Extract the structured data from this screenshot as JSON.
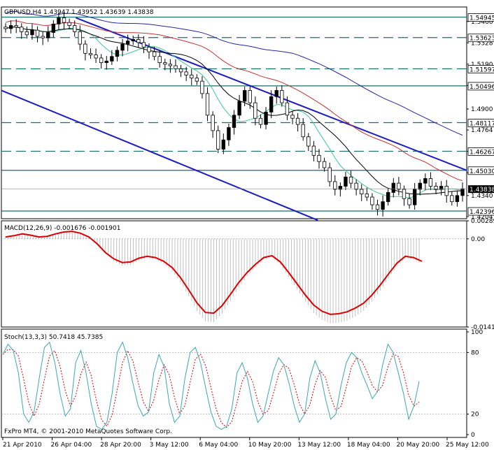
{
  "chart_data": [
    {
      "type": "candlestick",
      "title": "GBPUSD,H4",
      "ohlc_values": [
        "1.43947",
        "1.43952",
        "1.43639",
        "1.43838"
      ],
      "y_axis_ticks": [
        "1.5466",
        "1.5328",
        "1.5190",
        "1.5052",
        "1.4900",
        "1.4764",
        "1.4626",
        "1.4488",
        "1.4340",
        "1.4204"
      ],
      "ylim": [
        1.419,
        1.556
      ],
      "horizontal_levels": [
        {
          "price": 1.54945,
          "label": "1.54945",
          "style": "solid"
        },
        {
          "price": 1.53623,
          "label": "1.53623",
          "style": "dashed"
        },
        {
          "price": 1.51597,
          "label": "1.51597",
          "style": "dashed"
        },
        {
          "price": 1.50496,
          "label": "1.50496",
          "style": "solid"
        },
        {
          "price": 1.48117,
          "label": "1.48117",
          "style": "dashed"
        },
        {
          "price": 1.46267,
          "label": "1.46267",
          "style": "dashed"
        },
        {
          "price": 1.4503,
          "label": "1.45030",
          "style": "solid"
        },
        {
          "price": 1.42396,
          "label": "1.42396",
          "style": "solid"
        }
      ],
      "current_price": {
        "price": 1.43838,
        "label": "1.43838"
      },
      "trend_channel": {
        "upper": {
          "from": [
            0.16,
            1.549
          ],
          "to": [
            1.0,
            1.4503
          ]
        },
        "lower": {
          "from": [
            0.0,
            1.502
          ],
          "to": [
            0.68,
            1.418
          ]
        }
      },
      "close_prices": [
        1.542,
        1.544,
        1.543,
        1.54,
        1.538,
        1.541,
        1.537,
        1.536,
        1.5395,
        1.545,
        1.549,
        1.546,
        1.544,
        1.54,
        1.532,
        1.526,
        1.525,
        1.523,
        1.52,
        1.521,
        1.524,
        1.528,
        1.532,
        1.534,
        1.535,
        1.533,
        1.53,
        1.527,
        1.524,
        1.52,
        1.519,
        1.518,
        1.516,
        1.514,
        1.512,
        1.51,
        1.508,
        1.5,
        1.486,
        1.476,
        1.464,
        1.47,
        1.478,
        1.486,
        1.495,
        1.502,
        1.494,
        1.484,
        1.48,
        1.488,
        1.498,
        1.502,
        1.494,
        1.486,
        1.484,
        1.48,
        1.472,
        1.466,
        1.46,
        1.456,
        1.452,
        1.443,
        1.438,
        1.44,
        1.446,
        1.442,
        1.438,
        1.435,
        1.433,
        1.428,
        1.425,
        1.43,
        1.436,
        1.442,
        1.438,
        1.432,
        1.428,
        1.438,
        1.442,
        1.445,
        1.44,
        1.438,
        1.44,
        1.434,
        1.43,
        1.434,
        1.4384
      ],
      "moving_averages": [
        {
          "color": "#3ec89a"
        },
        {
          "color": "#000000"
        },
        {
          "color": "#c83232"
        },
        {
          "color": "#2626a0"
        }
      ],
      "x_axis_ticks": [
        "21 Apr 2010",
        "26 Apr 04:00",
        "28 Apr 20:00",
        "3 May 12:00",
        "6 May 04:00",
        "10 May 20:00",
        "13 May 12:00",
        "18 May 04:00",
        "20 May 20:00",
        "25 May 12:00"
      ],
      "copyright": "FxPro MT4, © 2001-2010 MetaQuotes Software Corp."
    },
    {
      "type": "macd",
      "title": "MACD(12,26,9)",
      "readout": [
        "-0.001676",
        "-0.001901"
      ],
      "y_axis_ticks": [
        "0.00289",
        "0.00",
        "-0.01413"
      ],
      "ylim": [
        -0.01413,
        0.00289
      ],
      "signal_color": "#dd0000",
      "histogram_color": "#c0c0c0",
      "main_values": [
        0.0003,
        0.0005,
        0.0008,
        0.0006,
        0.0003,
        0.0004,
        0.0008,
        0.0011,
        0.0012,
        0.0009,
        0.0003,
        -0.0008,
        -0.0022,
        -0.0032,
        -0.0038,
        -0.0037,
        -0.0031,
        -0.0028,
        -0.003,
        -0.0036,
        -0.0046,
        -0.0062,
        -0.0082,
        -0.0103,
        -0.0118,
        -0.0119,
        -0.0107,
        -0.0089,
        -0.007,
        -0.0054,
        -0.0041,
        -0.003,
        -0.0027,
        -0.0037,
        -0.0054,
        -0.0072,
        -0.009,
        -0.0106,
        -0.0116,
        -0.0121,
        -0.012,
        -0.0117,
        -0.0111,
        -0.0103,
        -0.009,
        -0.0074,
        -0.0056,
        -0.0039,
        -0.0028,
        -0.003,
        -0.0036
      ]
    },
    {
      "type": "stochastic",
      "title": "Stoch(13,3,3)",
      "readout": [
        "50.7418",
        "45.7385"
      ],
      "y_axis_ticks": [
        "100",
        "80",
        "20",
        "0"
      ],
      "ylim": [
        0,
        100
      ],
      "main_color": "#3aa8b0",
      "signal_color": "#dd0000",
      "main_values": [
        78,
        88,
        82,
        60,
        20,
        12,
        22,
        55,
        85,
        90,
        70,
        40,
        18,
        25,
        70,
        82,
        60,
        30,
        8,
        5,
        12,
        40,
        80,
        90,
        75,
        50,
        28,
        18,
        22,
        60,
        78,
        66,
        30,
        12,
        18,
        55,
        80,
        85,
        70,
        45,
        22,
        8,
        5,
        8,
        25,
        60,
        70,
        55,
        30,
        12,
        18,
        40,
        62,
        75,
        68,
        50,
        28,
        12,
        20,
        55,
        72,
        60,
        35,
        15,
        20,
        48,
        70,
        80,
        75,
        60,
        48,
        35,
        42,
        68,
        88,
        80,
        60,
        40,
        15,
        28,
        52
      ]
    }
  ]
}
